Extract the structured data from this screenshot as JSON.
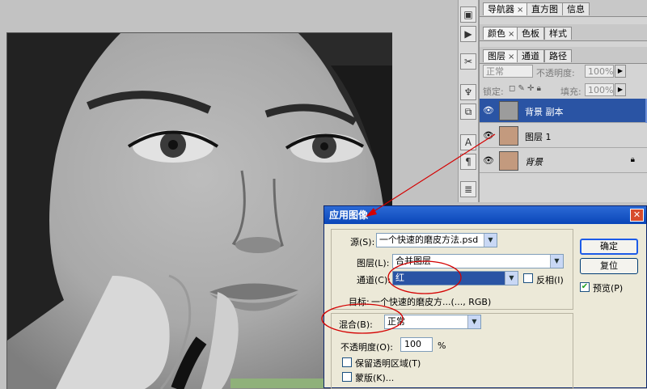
{
  "panels": {
    "nav_tabs": [
      {
        "label": "导航器",
        "closable": true
      },
      {
        "label": "直方图"
      },
      {
        "label": "信息"
      }
    ],
    "color_tabs": [
      {
        "label": "颜色",
        "closable": true
      },
      {
        "label": "色板"
      },
      {
        "label": "样式"
      }
    ],
    "layer_tabs": [
      {
        "label": "图层",
        "closable": true
      },
      {
        "label": "通道"
      },
      {
        "label": "路径"
      }
    ],
    "blend_mode": "正常",
    "opacity_label": "不透明度:",
    "opacity_value": "100%",
    "lock_label": "锁定:",
    "fill_label": "填充:",
    "fill_value": "100%",
    "layers": [
      {
        "name": "背景 副本",
        "selected": true,
        "thumb": "gray"
      },
      {
        "name": "图层 1",
        "selected": false,
        "thumb": "color"
      },
      {
        "name": "背景",
        "selected": false,
        "thumb": "color",
        "italic": true,
        "locked": true
      }
    ]
  },
  "dialog": {
    "title": "应用图像",
    "source_label": "源(S):",
    "source_value": "一个快速的磨皮方法.psd",
    "layer_label": "图层(L):",
    "layer_value": "合并图层",
    "channel_label": "通道(C):",
    "channel_value": "红",
    "invert_label": "反相(I)",
    "target_label": "目标:",
    "target_value": "一个快速的磨皮方...(..., RGB)",
    "blending_label": "混合(B):",
    "blending_value": "正常",
    "opacity_label": "不透明度(O):",
    "opacity_value": "100",
    "percent": "%",
    "preserve_label": "保留透明区域(T)",
    "mask_label": "蒙版(K)...",
    "ok_label": "确定",
    "reset_label": "复位",
    "preview_label": "预览(P)",
    "preview_checked": true
  },
  "colors": {
    "selection_blue": "#2a54a4",
    "annotation_red": "#d40000",
    "titlebar_blue": "#0a46b8"
  }
}
